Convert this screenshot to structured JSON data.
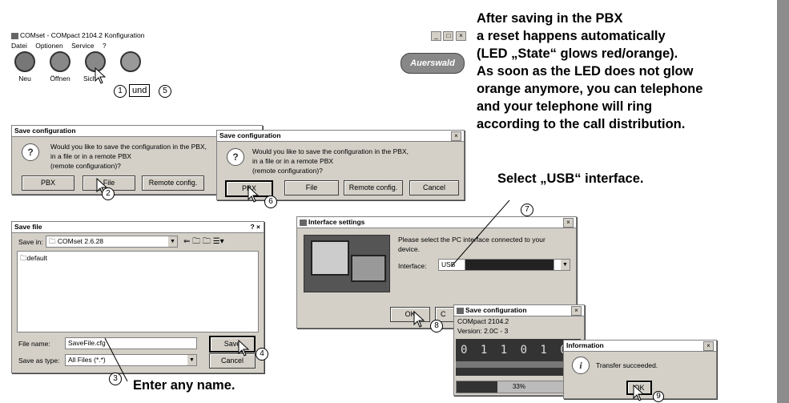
{
  "main_window": {
    "title": "COMset - COMpact 2104.2 Konfiguration",
    "menu": [
      "Datei",
      "Optionen",
      "Service",
      "?"
    ],
    "toolbar": [
      "Neu",
      "Öffnen",
      "Sich"
    ],
    "logo": "Auerswald",
    "win_buttons": [
      "_",
      "□",
      "×"
    ]
  },
  "step_markers": {
    "s1": "1",
    "und": "und",
    "s5": "5",
    "s2": "2",
    "s6": "6",
    "s3": "3",
    "s4": "4",
    "s7": "7",
    "s8": "8",
    "s9": "9"
  },
  "save_config_1": {
    "title": "Save configuration",
    "message_l1": "Would you like to save the configuration in the PBX,",
    "message_l2": "in a file or in a remote PBX",
    "message_l3": "(remote configuration)?",
    "buttons": [
      "PBX",
      "File",
      "Remote config."
    ]
  },
  "save_config_2": {
    "title": "Save configuration",
    "message_l1": "Would you like to save the configuration in the PBX,",
    "message_l2": "in a file or in a remote PBX",
    "message_l3": "(remote configuration)?",
    "buttons": [
      "PBX",
      "File",
      "Remote config.",
      "Cancel"
    ]
  },
  "save_file": {
    "title": "Save file",
    "title_right": "? ×",
    "save_in_label": "Save in:",
    "save_in_value": "COMset 2.6.28",
    "folder_item": "default",
    "file_name_label": "File name:",
    "file_name_value": "SaveFile.cfg",
    "save_as_label": "Save as type:",
    "save_as_value": "All Files (*.*)",
    "save_button": "Save",
    "cancel_button": "Cancel"
  },
  "interface_settings": {
    "title": "Interface settings",
    "message_l1": "Please select the PC interface connected to your",
    "message_l2": "device.",
    "interface_label": "Interface:",
    "interface_value": "USB",
    "ok_button": "OK",
    "cancel_button_partial": "C"
  },
  "save_progress": {
    "title": "Save configuration",
    "device": "COMpact 2104.2",
    "version": "Version: 2.0C - 3",
    "bits": "0 1 1 0 1 0",
    "progress_percent": 33,
    "progress_label": "33%"
  },
  "information": {
    "title": "Information",
    "message": "Transfer succeeded.",
    "ok_button": "OK"
  },
  "annotations": {
    "after_saving": [
      "After saving in the PBX",
      "a reset happens automatically",
      "(LED „State“ glows red/orange).",
      "As soon as the LED does not glow",
      "orange anymore, you can telephone",
      "and your telephone will ring",
      "according to the call distribution."
    ],
    "select_usb": "Select „USB“ interface.",
    "enter_name": "Enter any name."
  },
  "colors": {
    "sidebar": "#8c8c8c",
    "dialog": "#d4d0c8",
    "display": "#333333"
  }
}
